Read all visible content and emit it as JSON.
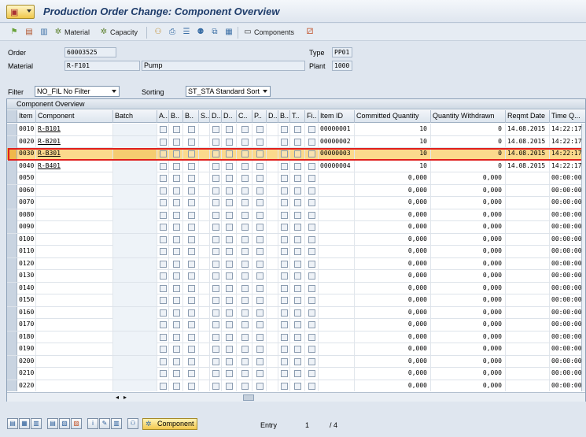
{
  "window": {
    "title": "Production Order Change: Component Overview"
  },
  "toolbar": {
    "material_label": "Material",
    "capacity_label": "Capacity",
    "components_label": "Components"
  },
  "header": {
    "order_label": "Order",
    "order_value": "60003525",
    "material_label": "Material",
    "material_value": "R-F101",
    "material_desc": "Pump",
    "type_label": "Type",
    "type_value": "PP01",
    "plant_label": "Plant",
    "plant_value": "1000",
    "filter_label": "Filter",
    "filter_value": "NO_FIL No Filter",
    "sorting_label": "Sorting",
    "sorting_value": "ST_STA Standard Sort"
  },
  "table": {
    "title": "Component Overview",
    "columns": [
      "Item",
      "Component",
      "Batch",
      "A..",
      "B..",
      "B..",
      "S..",
      "D..",
      "D..",
      "C..",
      "P..",
      "D..",
      "B..",
      "T..",
      "Fi..",
      "Item ID",
      "Committed Quantity",
      "Quantity Withdrawn",
      "Reqmt Date",
      "Time Q..."
    ],
    "rows": [
      {
        "item": "0010",
        "component": "R-B101",
        "item_id": "00000001",
        "committed": "10",
        "withdrawn": "0",
        "date": "14.08.2015",
        "time": "14:22:17"
      },
      {
        "item": "0020",
        "component": "R-B201",
        "item_id": "00000002",
        "committed": "10",
        "withdrawn": "0",
        "date": "14.08.2015",
        "time": "14:22:17"
      },
      {
        "item": "0030",
        "component": "R-B301",
        "item_id": "00000003",
        "committed": "10",
        "withdrawn": "0",
        "date": "14.08.2015",
        "time": "14:22:17"
      },
      {
        "item": "0040",
        "component": "R-B401",
        "item_id": "00000004",
        "committed": "10",
        "withdrawn": "0",
        "date": "14.08.2015",
        "time": "14:22:17"
      },
      {
        "item": "0050",
        "component": "",
        "item_id": "",
        "committed": "0,000",
        "withdrawn": "0,000",
        "date": "",
        "time": "00:00:00"
      },
      {
        "item": "0060",
        "component": "",
        "item_id": "",
        "committed": "0,000",
        "withdrawn": "0,000",
        "date": "",
        "time": "00:00:00"
      },
      {
        "item": "0070",
        "component": "",
        "item_id": "",
        "committed": "0,000",
        "withdrawn": "0,000",
        "date": "",
        "time": "00:00:00"
      },
      {
        "item": "0080",
        "component": "",
        "item_id": "",
        "committed": "0,000",
        "withdrawn": "0,000",
        "date": "",
        "time": "00:00:00"
      },
      {
        "item": "0090",
        "component": "",
        "item_id": "",
        "committed": "0,000",
        "withdrawn": "0,000",
        "date": "",
        "time": "00:00:00"
      },
      {
        "item": "0100",
        "component": "",
        "item_id": "",
        "committed": "0,000",
        "withdrawn": "0,000",
        "date": "",
        "time": "00:00:00"
      },
      {
        "item": "0110",
        "component": "",
        "item_id": "",
        "committed": "0,000",
        "withdrawn": "0,000",
        "date": "",
        "time": "00:00:00"
      },
      {
        "item": "0120",
        "component": "",
        "item_id": "",
        "committed": "0,000",
        "withdrawn": "0,000",
        "date": "",
        "time": "00:00:00"
      },
      {
        "item": "0130",
        "component": "",
        "item_id": "",
        "committed": "0,000",
        "withdrawn": "0,000",
        "date": "",
        "time": "00:00:00"
      },
      {
        "item": "0140",
        "component": "",
        "item_id": "",
        "committed": "0,000",
        "withdrawn": "0,000",
        "date": "",
        "time": "00:00:00"
      },
      {
        "item": "0150",
        "component": "",
        "item_id": "",
        "committed": "0,000",
        "withdrawn": "0,000",
        "date": "",
        "time": "00:00:00"
      },
      {
        "item": "0160",
        "component": "",
        "item_id": "",
        "committed": "0,000",
        "withdrawn": "0,000",
        "date": "",
        "time": "00:00:00"
      },
      {
        "item": "0170",
        "component": "",
        "item_id": "",
        "committed": "0,000",
        "withdrawn": "0,000",
        "date": "",
        "time": "00:00:00"
      },
      {
        "item": "0180",
        "component": "",
        "item_id": "",
        "committed": "0,000",
        "withdrawn": "0,000",
        "date": "",
        "time": "00:00:00"
      },
      {
        "item": "0190",
        "component": "",
        "item_id": "",
        "committed": "0,000",
        "withdrawn": "0,000",
        "date": "",
        "time": "00:00:00"
      },
      {
        "item": "0200",
        "component": "",
        "item_id": "",
        "committed": "0,000",
        "withdrawn": "0,000",
        "date": "",
        "time": "00:00:00"
      },
      {
        "item": "0210",
        "component": "",
        "item_id": "",
        "committed": "0,000",
        "withdrawn": "0,000",
        "date": "",
        "time": "00:00:00"
      },
      {
        "item": "0220",
        "component": "",
        "item_id": "",
        "committed": "0,000",
        "withdrawn": "0,000",
        "date": "",
        "time": "00:00:00"
      }
    ],
    "selected_index": 2
  },
  "bottom": {
    "component_button": "Component",
    "entry_label": "Entry",
    "entry_current": "1",
    "entry_total": "/ 4"
  },
  "colors": {
    "selected_row": "#fbd98c",
    "highlight_border": "#e0201e",
    "title": "#1f3d6b"
  }
}
